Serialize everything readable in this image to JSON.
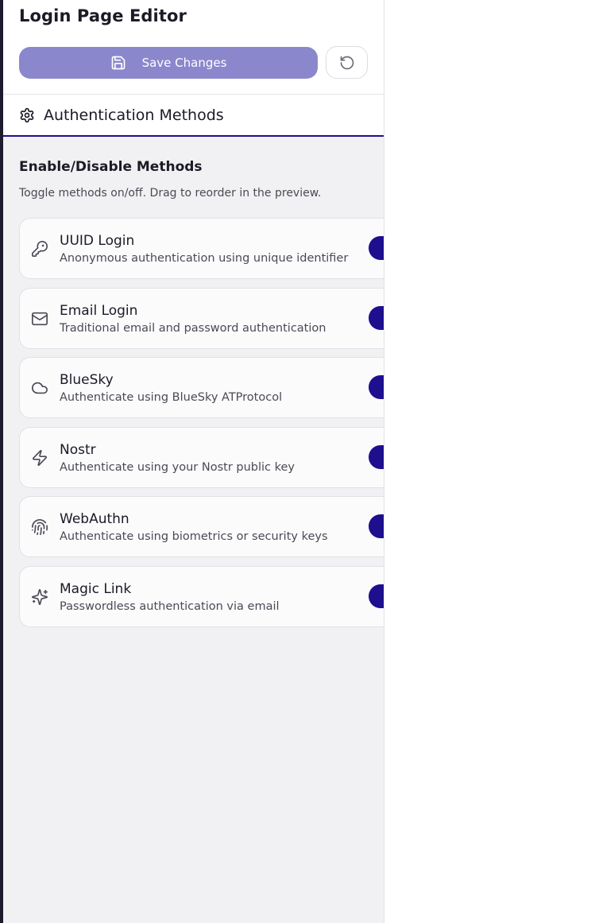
{
  "editor": {
    "title": "Login Page Editor",
    "save_label": "Save Changes",
    "reset_icon": "rotate-ccw-icon",
    "save_icon": "save-icon"
  },
  "tab": {
    "label": "Authentication Methods",
    "icon": "gear-icon",
    "accent_color": "#1e0f8f"
  },
  "section": {
    "title": "Enable/Disable Methods",
    "description": "Toggle methods on/off. Drag to reorder in the preview."
  },
  "methods": [
    {
      "name": "UUID Login",
      "description": "Anonymous authentication using unique identifier",
      "icon": "key-icon",
      "enabled": true
    },
    {
      "name": "Email Login",
      "description": "Traditional email and password authentication",
      "icon": "mail-icon",
      "enabled": true
    },
    {
      "name": "BlueSky",
      "description": "Authenticate using BlueSky ATProtocol",
      "icon": "cloud-icon",
      "enabled": true
    },
    {
      "name": "Nostr",
      "description": "Authenticate using your Nostr public key",
      "icon": "zap-icon",
      "enabled": true
    },
    {
      "name": "WebAuthn",
      "description": "Authenticate using biometrics or security keys",
      "icon": "fingerprint-icon",
      "enabled": true
    },
    {
      "name": "Magic Link",
      "description": "Passwordless authentication via email",
      "icon": "sparkles-icon",
      "enabled": true
    }
  ],
  "colors": {
    "save_button_bg": "#8b87cc",
    "toggle_on": "#1e0f8f",
    "panel_bg": "#f1f1f3"
  }
}
